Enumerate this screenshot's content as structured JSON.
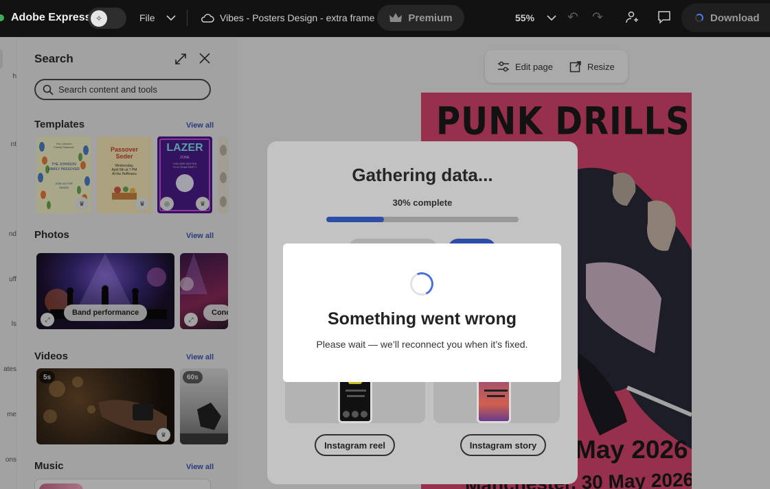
{
  "topbar": {
    "app_name": "Adobe Express",
    "file_label": "File",
    "document_title": "Vibes - Posters Design - extra frame",
    "premium_label": "Premium",
    "zoom": "55%",
    "download_label": "Download"
  },
  "rail": {
    "items": [
      "h",
      "nt",
      "nd",
      "uff",
      "ls",
      "ates",
      "me",
      "ons"
    ]
  },
  "panel": {
    "title": "Search",
    "search_placeholder": "Search content and tools",
    "view_all": "View all",
    "sections": {
      "templates": "Templates",
      "photos": "Photos",
      "videos": "Videos",
      "music": "Music"
    },
    "templates": [
      {
        "lines": [
          "The Johnson",
          "Family Passover",
          "THE JOHNSON",
          "FAMILY PASSOVER",
          "JOIN US FOR",
          "SEDER"
        ]
      },
      {
        "title": "Passover Seder",
        "lines": [
          "Wednesday,",
          "April 5th at 7 PM",
          "At the Hoffmans"
        ]
      },
      {
        "title": "LAZER",
        "subtitle": "ZONE",
        "lines": [
          "YOU ARE INVITED",
          "TO A TEAM PARTY"
        ]
      }
    ],
    "photos": [
      {
        "label": "Band performance"
      },
      {
        "label": "Conc"
      }
    ],
    "videos": [
      {
        "duration": "5s"
      },
      {
        "duration": "60s"
      }
    ]
  },
  "canvas": {
    "edit_page_label": "Edit page",
    "resize_label": "Resize",
    "poster": {
      "title": "PUNK DRILLS",
      "date": "May 2026",
      "venue": "Manchester, 30 May 2026"
    }
  },
  "gathering_dialog": {
    "title": "Gathering data...",
    "progress_text": "30% complete",
    "progress_fraction": 0.3,
    "options": [
      {
        "label": "Instagram reel"
      },
      {
        "label": "Instagram story"
      }
    ]
  },
  "error_modal": {
    "title": "Something went wrong",
    "message": "Please wait — we’ll reconnect you when it’s fixed."
  },
  "colors": {
    "accent": "#2d4ea5",
    "poster_bg": "#d9466e",
    "topbar_bg": "#121212"
  }
}
